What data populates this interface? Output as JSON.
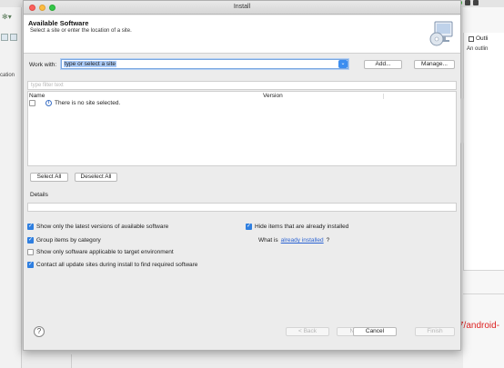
{
  "background": {
    "left_location_label": "cation",
    "right_tab_label": "Outli",
    "right_sub_label": "An outlin",
    "right_red_text": "7/android-"
  },
  "window": {
    "title": "Install"
  },
  "header": {
    "title": "Available Software",
    "subtitle": "Select a site or enter the location of a site."
  },
  "work_with": {
    "label": "Work with:",
    "value": "type or select a site",
    "add_label": "Add...",
    "manage_label": "Manage..."
  },
  "filter": {
    "placeholder": "type filter text"
  },
  "table": {
    "columns": [
      "Name",
      "Version"
    ],
    "rows": [
      "There is no site selected."
    ]
  },
  "select_all_label": "Select All",
  "deselect_all_label": "Deselect All",
  "details_label": "Details",
  "options": {
    "latest_versions": {
      "label": "Show only the latest versions of available software",
      "checked": true
    },
    "group_by_category": {
      "label": "Group items by category",
      "checked": true
    },
    "target_env": {
      "label": "Show only software applicable to target environment",
      "checked": false
    },
    "contact_sites": {
      "label": "Contact all update sites during install to find required software",
      "checked": true
    },
    "hide_installed": {
      "label": "Hide items that are already installed",
      "checked": true
    },
    "what_is_prefix": "What is ",
    "what_is_link": "already installed",
    "what_is_suffix": "?"
  },
  "footer": {
    "help_icon": "?",
    "back_label": "< Back",
    "next_label": "Next >",
    "cancel_label": "Cancel",
    "finish_label": "Finish"
  },
  "colors": {
    "accent": "#2f7fe0",
    "link": "#2a62d2",
    "selection": "#a9c9f5"
  }
}
